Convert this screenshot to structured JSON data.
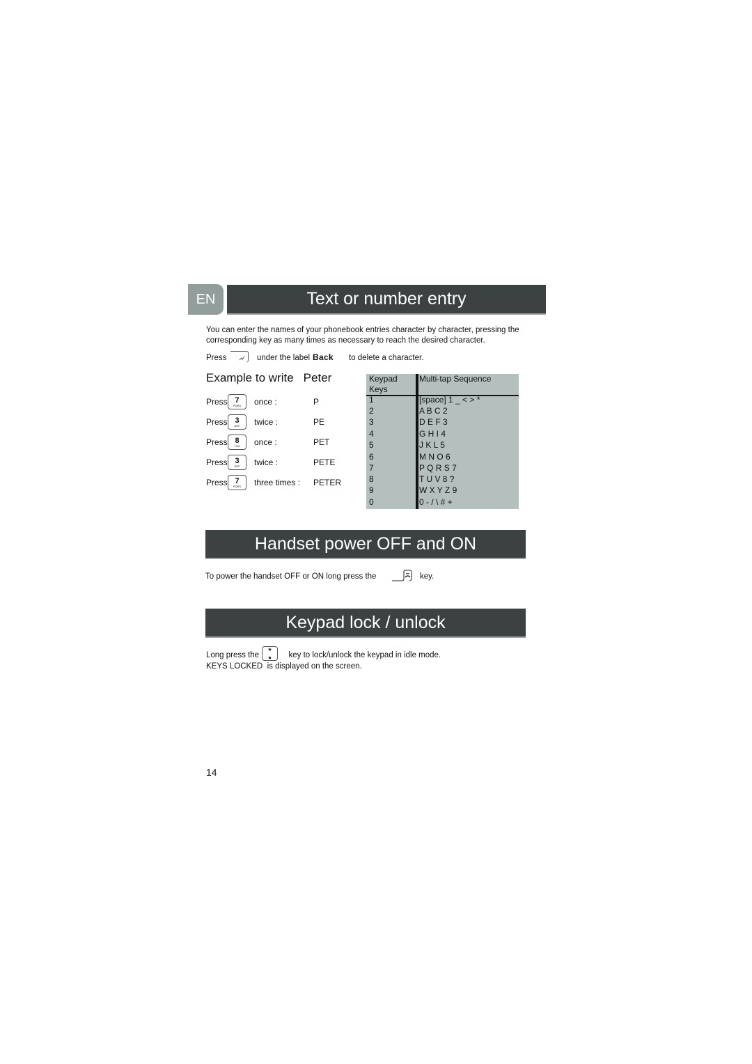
{
  "language_tab": "EN",
  "sections": {
    "text_entry": {
      "title": "Text or number entry",
      "intro_line1": "You can enter the names of your phonebook entries character by character, pressing the",
      "intro_line2": "corresponding key as many times as necessary to reach the desired character.",
      "delete_prefix": "Press",
      "delete_middle": "under the label",
      "delete_label": "Back",
      "delete_suffix": "to delete a character.",
      "delete_key_icon": "right-softkey-icon"
    },
    "example": {
      "title": "Example to write",
      "word": "Peter",
      "rows": [
        {
          "press": "Press",
          "key_digit": "7",
          "key_letters": "PQRS",
          "times": "once :",
          "result": "P"
        },
        {
          "press": "Press",
          "key_digit": "3",
          "key_letters": "DEF",
          "times": "twice :",
          "result": "PE"
        },
        {
          "press": "Press",
          "key_digit": "8",
          "key_letters": "TUV",
          "times": "once :",
          "result": "PET"
        },
        {
          "press": "Press",
          "key_digit": "3",
          "key_letters": "DEF",
          "times": "twice :",
          "result": "PETE"
        },
        {
          "press": "Press",
          "key_digit": "7",
          "key_letters": "PQRS",
          "times": "three times :",
          "result": "PETER"
        }
      ]
    },
    "keypad_table": {
      "header_key_line1": "Keypad",
      "header_key_line2": "Keys",
      "header_sequence": "Multi-tap Sequence",
      "rows": [
        {
          "key": "1",
          "sequence": "[space] 1 _ < > *"
        },
        {
          "key": "2",
          "sequence": "A B C 2"
        },
        {
          "key": "3",
          "sequence": "D E F 3"
        },
        {
          "key": "4",
          "sequence": "G H I 4"
        },
        {
          "key": "5",
          "sequence": "J K L 5"
        },
        {
          "key": "6",
          "sequence": "M N O 6"
        },
        {
          "key": "7",
          "sequence": "P Q R S 7"
        },
        {
          "key": "8",
          "sequence": "T U V 8 ?"
        },
        {
          "key": "9",
          "sequence": "W X Y Z 9"
        },
        {
          "key": "0",
          "sequence": "0 - / \\ # +"
        }
      ]
    },
    "power": {
      "title": "Handset power OFF and ON",
      "text": "To power the handset OFF or ON long press the",
      "key_icon": "end-call-key-icon",
      "suffix": "key."
    },
    "lock": {
      "title": "Keypad lock / unlock",
      "line1_prefix": "Long press the",
      "key_icon": "star-key-icon",
      "line1_suffix": "key to lock/unlock the keypad in idle mode.",
      "line2_bold": "KEYS LOCKED",
      "line2_rest": "is displayed on the screen."
    }
  },
  "page_number": "14",
  "colors": {
    "header_bg": "#3c4242",
    "lang_tab_bg": "#929e9c",
    "table_bg": "#b5bfbd"
  }
}
